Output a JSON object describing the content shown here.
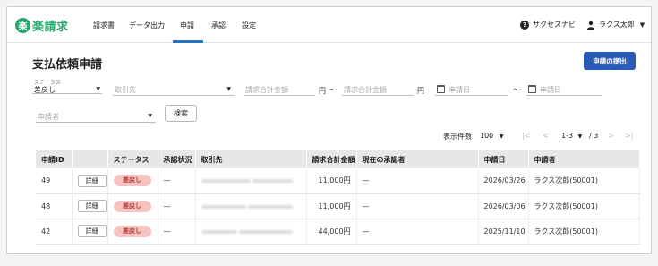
{
  "app": {
    "logo_mark": "楽",
    "logo_text": "楽請求"
  },
  "nav": {
    "items": [
      {
        "label": "請求書"
      },
      {
        "label": "データ出力"
      },
      {
        "label": "申請"
      },
      {
        "label": "承認"
      },
      {
        "label": "設定"
      }
    ],
    "active_index": 2,
    "help_label": "サクセスナビ",
    "user_label": "ラクス太郎"
  },
  "page": {
    "title": "支払依頼申請",
    "submit_label": "申請の提出"
  },
  "filters": {
    "status_label": "ステータス",
    "status_value": "差戻し",
    "partner_placeholder": "取引先",
    "amount_from_placeholder": "請求合計金額",
    "amount_unit": "円",
    "range_sep": "〜",
    "amount_to_placeholder": "請求合計金額",
    "amount_unit_2": "円",
    "date_from_placeholder": "申請日",
    "date_sep": "〜",
    "date_to_placeholder": "申請日",
    "applicant_placeholder": "申請者",
    "search_label": "検索"
  },
  "pagination": {
    "per_page_label": "表示件数",
    "per_page_value": "100",
    "first": "|<",
    "prev": "<",
    "range": "1-3",
    "of": "/ 3",
    "next": ">",
    "last": ">|"
  },
  "table": {
    "headers": [
      "申請ID",
      "",
      "ステータス",
      "承認状況",
      "取引先",
      "請求合計金額",
      "現在の承認者",
      "申請日",
      "申請者"
    ],
    "rows": [
      {
        "id": "49",
        "detail": "詳細",
        "status": "差戻し",
        "approval": "—",
        "partner_blurred": true,
        "amount": "11,000円",
        "approver": "—",
        "date": "2026/03/26",
        "applicant": "ラクス次郎(50001)"
      },
      {
        "id": "48",
        "detail": "詳細",
        "status": "差戻し",
        "approval": "—",
        "partner_blurred": true,
        "amount": "11,000円",
        "approver": "—",
        "date": "2026/03/06",
        "applicant": "ラクス次郎(50001)"
      },
      {
        "id": "42",
        "detail": "詳細",
        "status": "差戻し",
        "approval": "—",
        "partner_blurred": true,
        "amount": "44,000円",
        "approver": "—",
        "date": "2025/11/10",
        "applicant": "ラクス次郎(50001)"
      }
    ]
  },
  "colors": {
    "brand": "#27a86f",
    "accent": "#2a5bb8",
    "badge_bg": "#f6c3c3",
    "badge_text": "#b3352f"
  },
  "icons": [
    "help-icon",
    "user-icon",
    "calendar-icon",
    "chevron-down-icon"
  ]
}
